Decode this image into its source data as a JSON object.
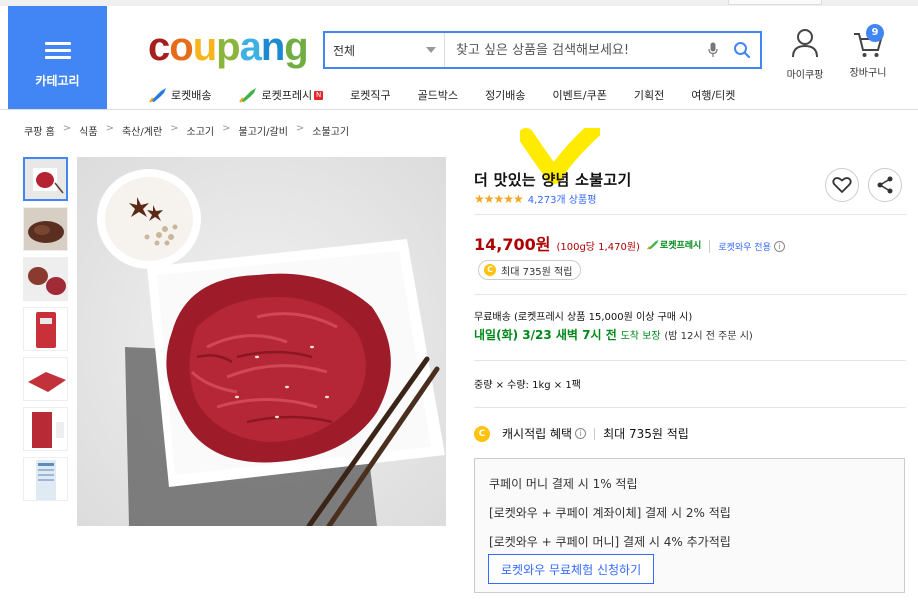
{
  "header": {
    "category_label": "카테고리",
    "logo_letters": [
      "c",
      "o",
      "u",
      "p",
      "a",
      "n",
      "g"
    ],
    "search": {
      "category": "전체",
      "placeholder": "찾고 싶은 상품을 검색해보세요!"
    },
    "my_coupang": "마이쿠팡",
    "cart": "장바구니",
    "cart_count": "9"
  },
  "nav": [
    {
      "label": "로켓배송",
      "icon": "rocket-icon"
    },
    {
      "label": "로켓프레시",
      "icon": "rocket-fresh-icon",
      "new": "N"
    },
    {
      "label": "로켓직구"
    },
    {
      "label": "골드박스"
    },
    {
      "label": "정기배송"
    },
    {
      "label": "이벤트/쿠폰"
    },
    {
      "label": "기획전"
    },
    {
      "label": "여행/티켓"
    }
  ],
  "breadcrumb": [
    "쿠팡 홈",
    "식품",
    "축산/계란",
    "소고기",
    "불고기/갈비",
    "소불고기"
  ],
  "product": {
    "title": "더 맛있는 양념 소불고기",
    "stars": "★★★★★",
    "review_count": "4,273개 상품평",
    "price": "14,700원",
    "unit_price": "(100g당 1,470원)",
    "rocket_fresh": "로켓프레시",
    "wow_only": "로켓와우 전용",
    "info": "i",
    "points_chip": "최대 735원 적립",
    "coin": "C",
    "shipping_note": "무료배송 (로켓프레시 상품 15,000원 이상 구매 시)",
    "delivery_day": "내일(화) 3/23 새벽 7시 전",
    "delivery_guarantee": "도착 보장",
    "delivery_cutoff": "(밤 12시 전 주문 시)",
    "option": "중량 × 수량: 1kg × 1팩",
    "cash_label": "캐시적립 혜택",
    "cash_value": "최대 735원 적립",
    "benefits": [
      "쿠페이 머니 결제 시 1% 적립",
      "[로켓와우 + 쿠페이 계좌이체] 결제 시 2% 적립",
      "[로켓와우 + 쿠페이 머니] 결제 시 4% 추가적립"
    ],
    "wow_trial_button": "로켓와우 무료체험 신청하기"
  },
  "colors": {
    "accent": "#4285f4",
    "price": "#ae0000",
    "fresh_green": "#00891a",
    "link_blue": "#346aff",
    "annotation_yellow": "#ffeb00"
  }
}
